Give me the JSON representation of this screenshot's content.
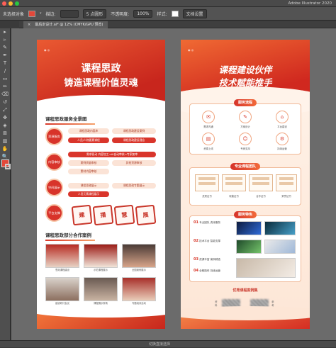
{
  "window": {
    "app_name": "Adobe Illustrator 2020"
  },
  "control_bar": {
    "selection": "未选择对象",
    "stroke_label": "描边:",
    "brush": "5 点圆形",
    "opacity_label": "不透明度:",
    "opacity_value": "100%",
    "style_label": "样式:",
    "doc_settings": "文档设置"
  },
  "tab": {
    "label": "最后定设计.ai* @ 12% (CMYK/GPU 预览)",
    "close": "×"
  },
  "tools": [
    "▸",
    "▹",
    "✎",
    "✒",
    "T",
    "/",
    "▭",
    "✏",
    "⌫",
    "↺",
    "⤢",
    "✥",
    "◈",
    "⊞",
    "▥",
    "✋",
    "🔍"
  ],
  "colors": {
    "fill": "#e3483a",
    "accent": "#d8382a"
  },
  "left_banner": {
    "title1": "课程思政",
    "title2": "铸造课程价值灵魂",
    "section1": "课程思政服务全景图",
    "categories": [
      "资源服务",
      "内容审核",
      "空间展示",
      "平台支撑"
    ],
    "row1": [
      "课程思政内容库",
      "课程思政建设案例"
    ],
    "row2": [
      "人员/人物要素课程",
      "课程思政建设理念"
    ],
    "row3": "需求驱动 内容加工→AI自动审核→专家复审",
    "row4": [
      "案例质量审核",
      "其他资源审核"
    ],
    "row5": [
      "素材内容审核"
    ],
    "row6": [
      "课程思政展示",
      "课程思政专题展示"
    ],
    "row7": "人员元素课程展示",
    "seals": [
      "建",
      "播",
      "慧",
      "展"
    ],
    "section2": "课程思政部分合作案例",
    "photos": [
      "思政课程建设",
      "示范课程展示",
      "全国案例展示",
      "建设研讨会议",
      "课程展示现场",
      "专题培训活动"
    ]
  },
  "right_banner": {
    "title1": "课程建设伙伴",
    "title2": "技术赋能推手",
    "pill1": "服务流程",
    "flow": [
      "需求沟通",
      "方案设计",
      "平台建设",
      "资源上线",
      "专家支持",
      "持续运营"
    ],
    "pill2": "专业课程团队",
    "certs": [
      "资质证书",
      "软著证书",
      "合作证书",
      "荣誉证书"
    ],
    "pill3": "服务特色",
    "features": [
      {
        "num": "01",
        "text": "专业团队 资深服务"
      },
      {
        "num": "02",
        "text": "技术平台 智能支撑"
      },
      {
        "num": "03",
        "text": "资源丰富 案例精选"
      },
      {
        "num": "04",
        "text": "全程陪伴 持续运营"
      }
    ],
    "footer_label": "优秀课程案例集",
    "qr_left_label": "资料",
    "qr_right_label": "参考"
  },
  "status_bar": {
    "text": "切换直接选择"
  }
}
